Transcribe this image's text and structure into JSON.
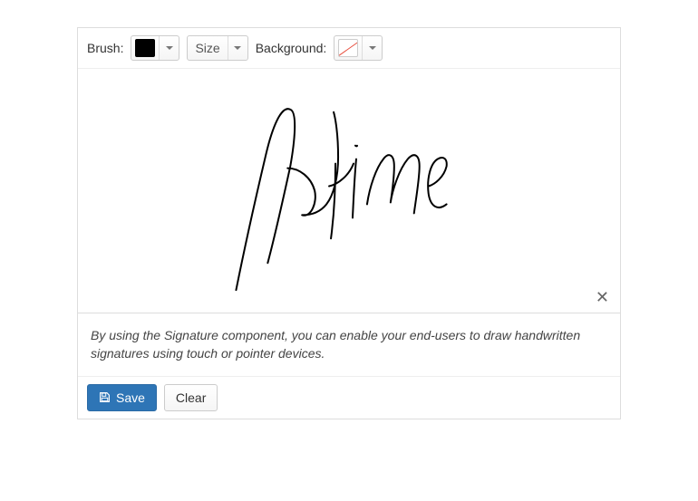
{
  "toolbar": {
    "brush_label": "Brush:",
    "size_label": "Size",
    "background_label": "Background:"
  },
  "canvas": {
    "close_symbol": "✕"
  },
  "description": "By using the Signature component, you can enable your end-users to draw handwritten signatures using touch or pointer devices.",
  "footer": {
    "save_label": "Save",
    "clear_label": "Clear"
  },
  "colors": {
    "brush": "#000000",
    "background": "transparent"
  }
}
